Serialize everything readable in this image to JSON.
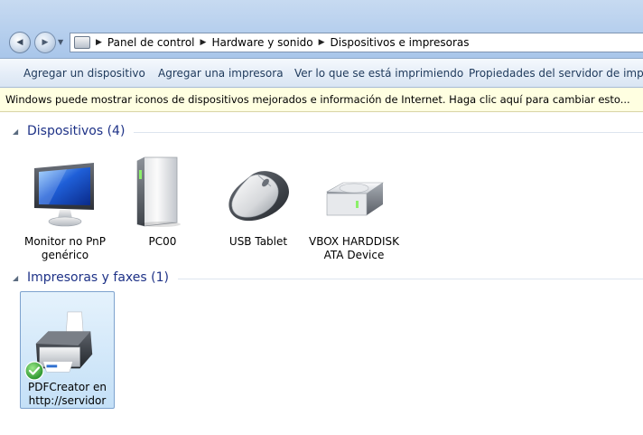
{
  "navigation": {
    "back_glyph": "◀",
    "forward_glyph": "▶",
    "dropdown_glyph": "▼"
  },
  "address_bar": {
    "separator": "▶",
    "crumbs": [
      "Panel de control",
      "Hardware y sonido",
      "Dispositivos e impresoras"
    ]
  },
  "toolbar": {
    "add_device": "Agregar un dispositivo",
    "add_printer": "Agregar una impresora",
    "see_printing": "Ver lo que se está imprimiendo",
    "server_properties": "Propiedades del servidor de impresión"
  },
  "infobar": {
    "text": "Windows puede mostrar iconos de dispositivos mejorados e información de Internet. Haga clic aquí para cambiar esto..."
  },
  "groups": {
    "devices": {
      "title": "Dispositivos (4)",
      "items": [
        {
          "label_line1": "Monitor no PnP",
          "label_line2": "genérico",
          "icon": "monitor-icon"
        },
        {
          "label_line1": "PC00",
          "label_line2": "",
          "icon": "computer-tower-icon"
        },
        {
          "label_line1": "USB Tablet",
          "label_line2": "",
          "icon": "mouse-icon"
        },
        {
          "label_line1": "VBOX HARDDISK",
          "label_line2": "ATA Device",
          "icon": "hard-drive-icon"
        }
      ]
    },
    "printers": {
      "title": "Impresoras y faxes (1)",
      "items": [
        {
          "label_line1": "PDFCreator en",
          "label_line2": "http://servidor",
          "icon": "printer-icon",
          "default": true
        }
      ]
    }
  },
  "colors": {
    "group_title": "#1e3287",
    "command_text": "#1e395b",
    "infobar_bg": "#ffffe1",
    "selection_border": "#7da2ce"
  }
}
